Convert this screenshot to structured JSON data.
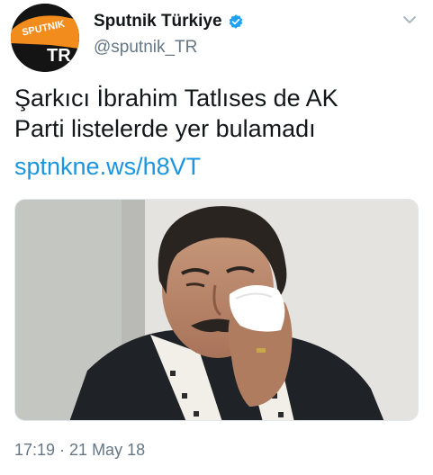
{
  "author": {
    "display_name": "Sputnik Türkiye",
    "handle": "@sputnik_TR",
    "verified": true,
    "avatar_logo_text": "SPUTNIK",
    "avatar_badge_text": "TR",
    "avatar_accent_color": "#f28c1c"
  },
  "tweet": {
    "text_line_1": "Şarkıcı İbrahim Tatlıses de AK",
    "text_line_2": "Parti listelerde yer bulamadı",
    "link": "sptnkne.ws/h8VT"
  },
  "media": {
    "type": "photo",
    "subject": "man wiping his eyes with a tissue"
  },
  "meta": {
    "timestamp": "17:19 · 21 May 18"
  },
  "icons": {
    "verified": "verified-badge-icon",
    "caret": "chevron-down-icon"
  },
  "colors": {
    "link": "#1b95e0",
    "secondary_text": "#657786",
    "verified_badge": "#1da1f2"
  }
}
